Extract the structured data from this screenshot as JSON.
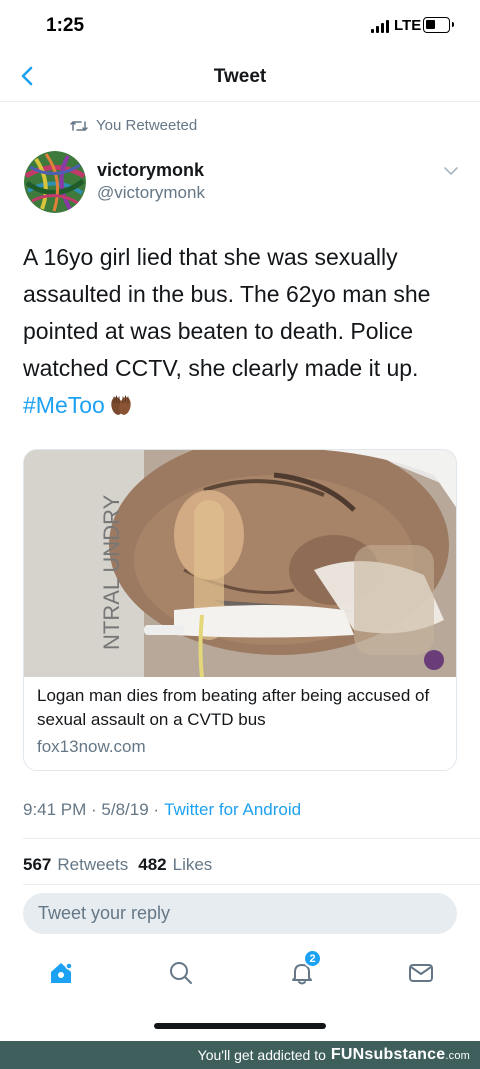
{
  "status_bar": {
    "time": "1:25",
    "network": "LTE"
  },
  "nav": {
    "title": "Tweet",
    "back_icon": "chevron-left-icon"
  },
  "retweet_context": {
    "icon": "retweet-icon",
    "label": "You Retweeted"
  },
  "tweet": {
    "author_name": "victorymonk",
    "author_handle": "@victorymonk",
    "text_lines": [
      "A 16yo girl lied that she was sexually",
      "assaulted in the bus. The 62yo man she",
      "pointed at was beaten to death. Police",
      "watched CCTV, she clearly made it up."
    ],
    "hashtag": "#MeToo",
    "timestamp": "9:41 PM · 5/8/19 ·",
    "source": "Twitter for Android"
  },
  "link_card": {
    "title": "Logan man dies from beating after being accused of sexual assault on a CVTD bus",
    "domain": "fox13now.com",
    "image_text": "NTRAL UNDRY"
  },
  "stats": {
    "retweets_count": "567",
    "retweets_label": "Retweets",
    "likes_count": "482",
    "likes_label": "Likes"
  },
  "reply": {
    "placeholder": "Tweet your reply"
  },
  "tab_bar": {
    "tabs": [
      "home-icon",
      "search-icon",
      "notifications-icon",
      "messages-icon"
    ],
    "notifications_badge": "2"
  },
  "watermark": {
    "text": "You'll get addicted to",
    "brand": "FUNsubstance",
    "brand_suffix": ".com"
  },
  "colors": {
    "accent": "#1da1f2",
    "secondary_text": "#657786",
    "watermark_bg": "#3e5f5c"
  }
}
